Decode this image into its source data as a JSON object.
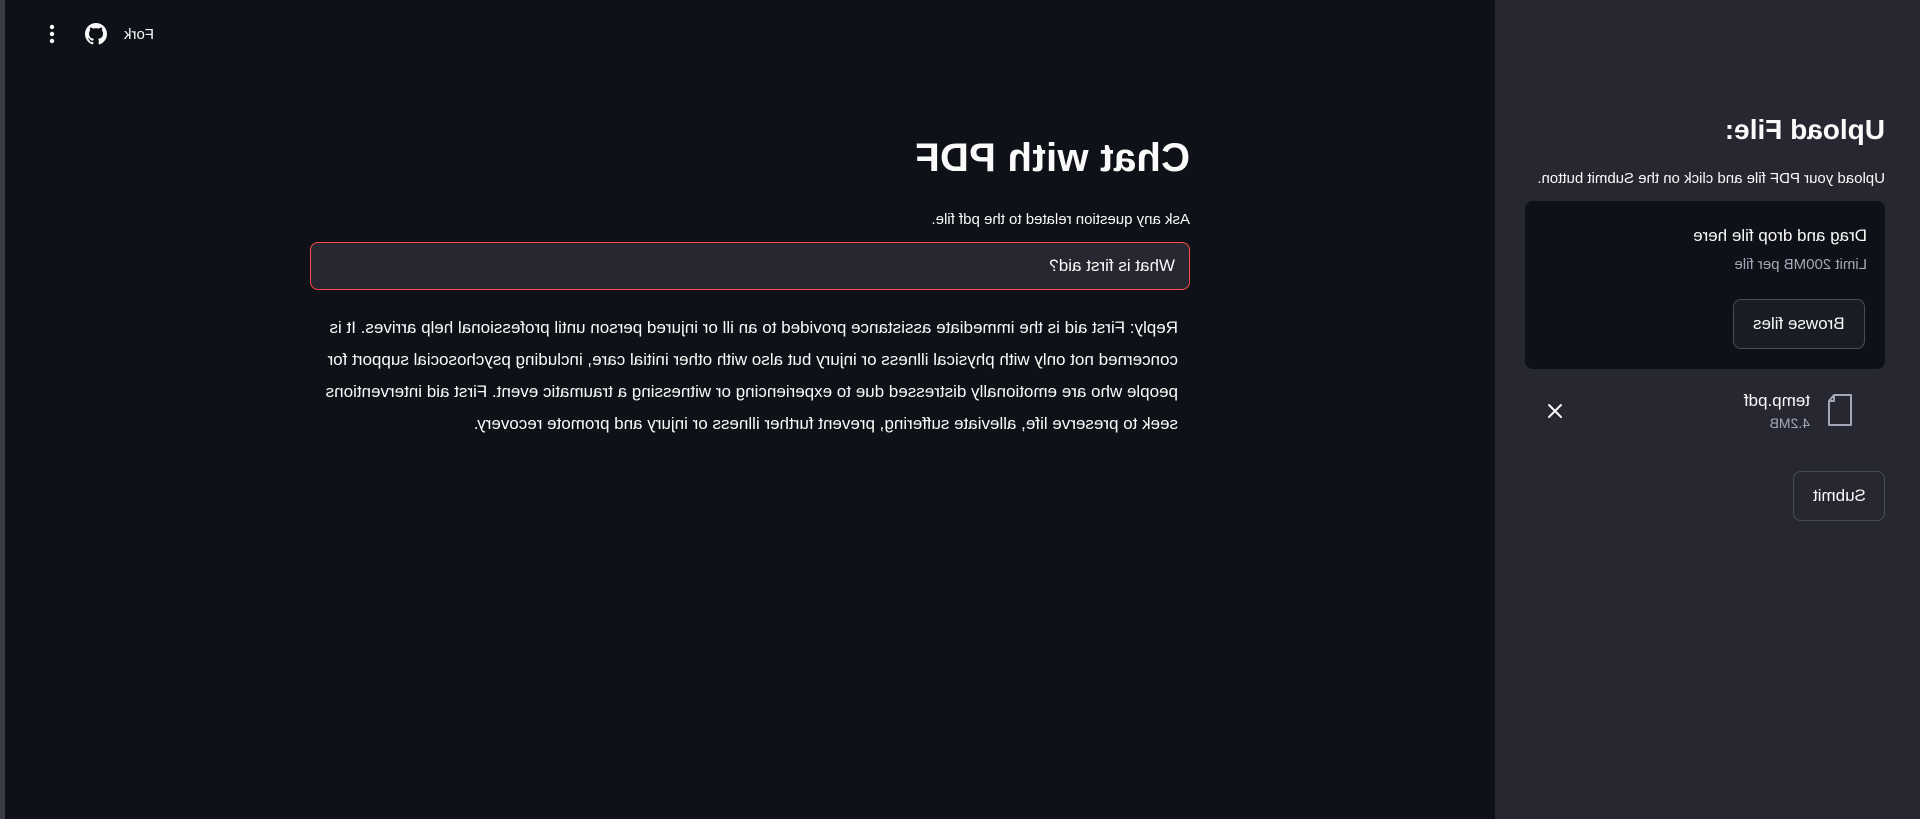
{
  "toolbar": {
    "fork_label": "Fork",
    "icons": [
      "more-vert-icon",
      "github-icon"
    ]
  },
  "main": {
    "title": "Chat with PDF",
    "question_label": "Ask any question related to the pdf file.",
    "question_value": "What is first aid?",
    "reply_text": "Reply: First aid is the immediate assistance provided to an ill or injured person until professional help arrives. It is concerned not only with physical illness or injury but also with other initial care, including psychosocial support for people who are emotionally distressed due to experiencing or witnessing a traumatic event. First aid interventions seek to preserve life, alleviate suffering, prevent further illness or injury and promote recovery."
  },
  "sidebar": {
    "title": "Upload File:",
    "description": "Upload your PDF file and click on the Submit button.",
    "dropzone": {
      "title": "Drag and drop file here",
      "limit": "Limit 200MB per file",
      "browse_label": "Browse files"
    },
    "file": {
      "name": "temp.pdf",
      "size": "4.2MB"
    },
    "submit_label": "Submit"
  },
  "colors": {
    "background": "#0e1117",
    "sidebar": "#262730",
    "input_focus_border": "#ff4b4b",
    "muted_text": "#a3a8b8"
  }
}
